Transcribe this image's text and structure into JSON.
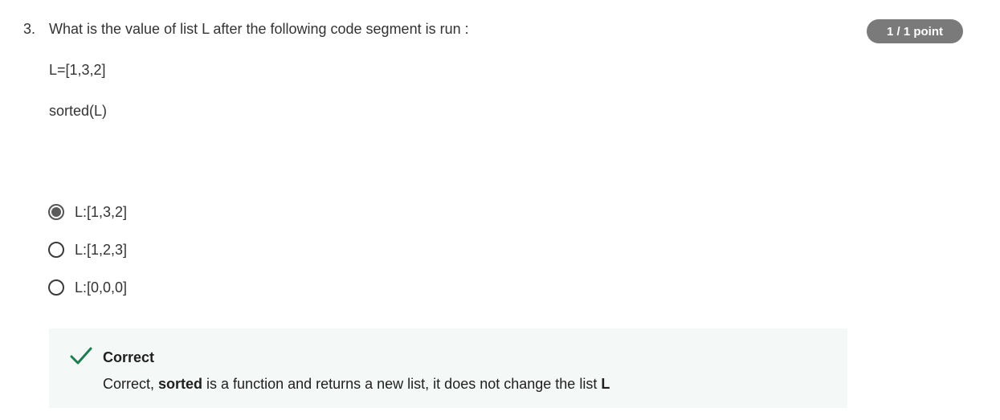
{
  "question": {
    "number": "3.",
    "title": "What is the value of list L after the following code segment is run  :",
    "points": "1 / 1 point",
    "code_lines": [
      "L=[1,3,2]",
      "sorted(L)"
    ]
  },
  "options": [
    {
      "label": "L:[1,3,2]",
      "selected": true
    },
    {
      "label": "L:[1,2,3]",
      "selected": false
    },
    {
      "label": "L:[0,0,0]",
      "selected": false
    }
  ],
  "feedback": {
    "status": "Correct",
    "text_prefix": "Correct, ",
    "text_bold1": "sorted",
    "text_middle": " is a function and returns a new list, it does not change the list ",
    "text_bold2": "L",
    "icon": "checkmark-icon",
    "accent_color": "#1d7c50",
    "background_color": "#f4f8f6"
  },
  "colors": {
    "badge_background": "#7a7a7a",
    "text": "#333333"
  }
}
